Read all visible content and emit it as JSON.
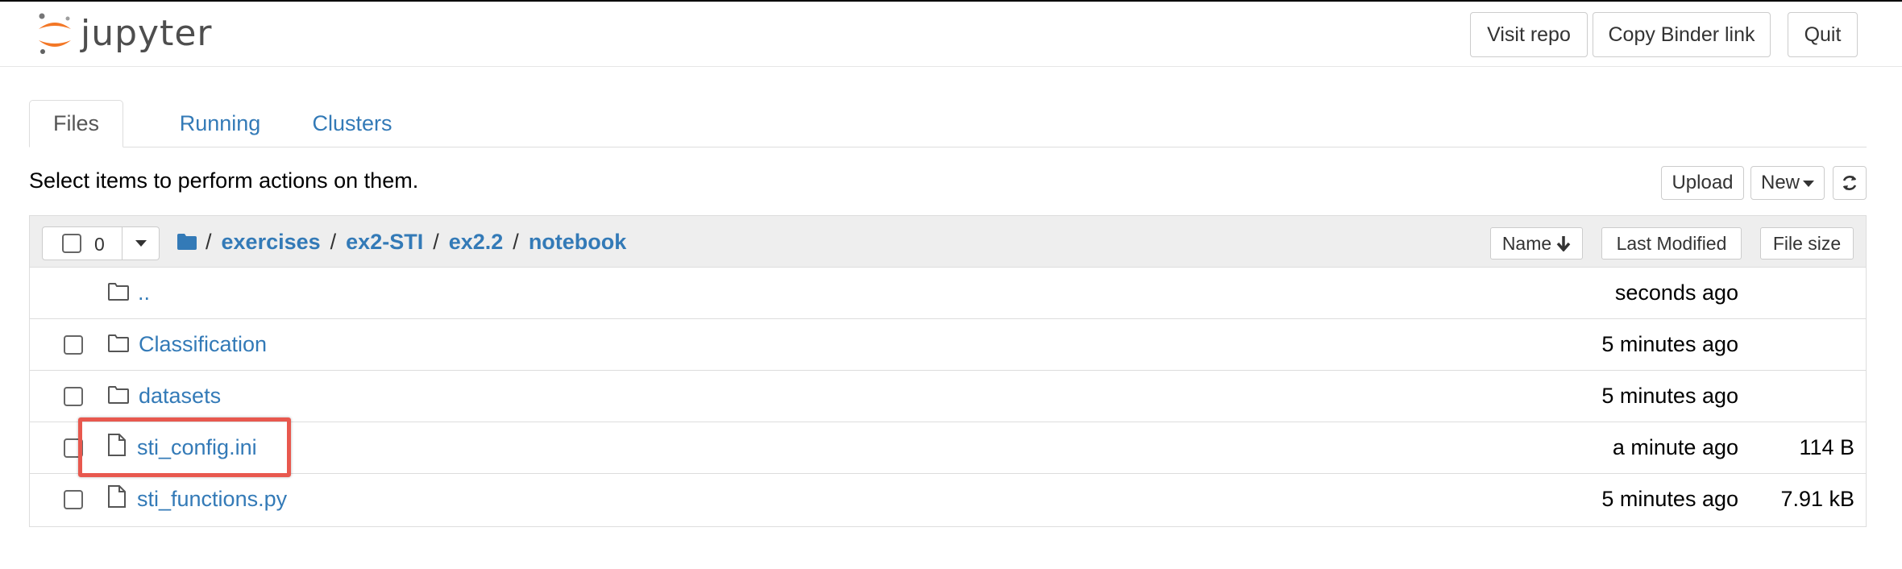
{
  "header": {
    "logo_text": "jupyter",
    "buttons": {
      "visit_repo": "Visit repo",
      "copy_binder": "Copy Binder link",
      "quit": "Quit"
    }
  },
  "tabs": [
    {
      "label": "Files",
      "active": true
    },
    {
      "label": "Running",
      "active": false
    },
    {
      "label": "Clusters",
      "active": false
    }
  ],
  "instructions": "Select items to perform actions on them.",
  "toolbar": {
    "upload": "Upload",
    "new": "New"
  },
  "list_header": {
    "selected_count": "0",
    "breadcrumb": [
      "exercises",
      "ex2-STI",
      "ex2.2",
      "notebook"
    ],
    "separator": "/",
    "columns": {
      "name": "Name",
      "last_modified": "Last Modified",
      "file_size": "File size"
    }
  },
  "rows": [
    {
      "name": "..",
      "type": "folder",
      "modified": "seconds ago",
      "size": ""
    },
    {
      "name": "Classification",
      "type": "folder",
      "modified": "5 minutes ago",
      "size": ""
    },
    {
      "name": "datasets",
      "type": "folder",
      "modified": "5 minutes ago",
      "size": ""
    },
    {
      "name": "sti_config.ini",
      "type": "file",
      "modified": "a minute ago",
      "size": "114 B"
    },
    {
      "name": "sti_functions.py",
      "type": "file",
      "modified": "5 minutes ago",
      "size": "7.91 kB"
    }
  ],
  "colors": {
    "link": "#337ab7",
    "highlight": "#e8584e",
    "logo_orange": "#f37726"
  }
}
